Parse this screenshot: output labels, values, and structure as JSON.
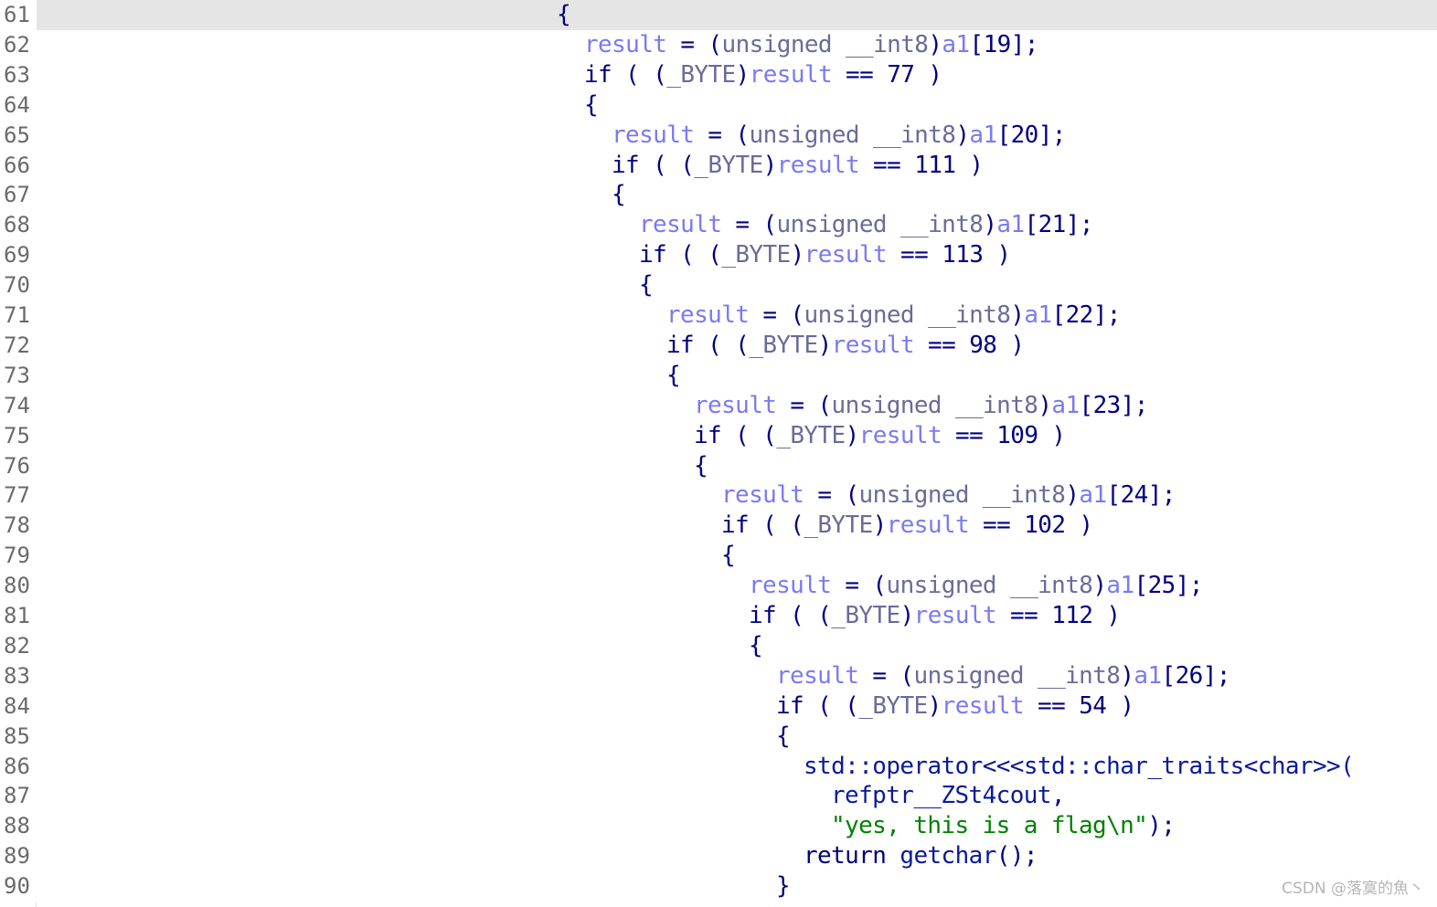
{
  "editor": {
    "lines": [
      {
        "num": "61",
        "indent": 0,
        "tokens": [
          {
            "t": "{",
            "c": "tk-plain"
          }
        ]
      },
      {
        "num": "62",
        "indent": 1,
        "tokens": [
          {
            "t": "result",
            "c": "tk-var"
          },
          {
            "t": " = (",
            "c": "tk-plain"
          },
          {
            "t": "unsigned __int8",
            "c": "tk-type"
          },
          {
            "t": ")",
            "c": "tk-plain"
          },
          {
            "t": "a1",
            "c": "tk-var"
          },
          {
            "t": "[19];",
            "c": "tk-plain"
          }
        ]
      },
      {
        "num": "63",
        "indent": 1,
        "tokens": [
          {
            "t": "if",
            "c": "tk-kw"
          },
          {
            "t": " ( (",
            "c": "tk-plain"
          },
          {
            "t": "_BYTE",
            "c": "tk-type"
          },
          {
            "t": ")",
            "c": "tk-plain"
          },
          {
            "t": "result",
            "c": "tk-var"
          },
          {
            "t": " == 77 )",
            "c": "tk-plain"
          }
        ]
      },
      {
        "num": "64",
        "indent": 1,
        "tokens": [
          {
            "t": "{",
            "c": "tk-plain"
          }
        ]
      },
      {
        "num": "65",
        "indent": 2,
        "tokens": [
          {
            "t": "result",
            "c": "tk-var"
          },
          {
            "t": " = (",
            "c": "tk-plain"
          },
          {
            "t": "unsigned __int8",
            "c": "tk-type"
          },
          {
            "t": ")",
            "c": "tk-plain"
          },
          {
            "t": "a1",
            "c": "tk-var"
          },
          {
            "t": "[20];",
            "c": "tk-plain"
          }
        ]
      },
      {
        "num": "66",
        "indent": 2,
        "tokens": [
          {
            "t": "if",
            "c": "tk-kw"
          },
          {
            "t": " ( (",
            "c": "tk-plain"
          },
          {
            "t": "_BYTE",
            "c": "tk-type"
          },
          {
            "t": ")",
            "c": "tk-plain"
          },
          {
            "t": "result",
            "c": "tk-var"
          },
          {
            "t": " == 111 )",
            "c": "tk-plain"
          }
        ]
      },
      {
        "num": "67",
        "indent": 2,
        "tokens": [
          {
            "t": "{",
            "c": "tk-plain"
          }
        ]
      },
      {
        "num": "68",
        "indent": 3,
        "tokens": [
          {
            "t": "result",
            "c": "tk-var"
          },
          {
            "t": " = (",
            "c": "tk-plain"
          },
          {
            "t": "unsigned __int8",
            "c": "tk-type"
          },
          {
            "t": ")",
            "c": "tk-plain"
          },
          {
            "t": "a1",
            "c": "tk-var"
          },
          {
            "t": "[21];",
            "c": "tk-plain"
          }
        ]
      },
      {
        "num": "69",
        "indent": 3,
        "tokens": [
          {
            "t": "if",
            "c": "tk-kw"
          },
          {
            "t": " ( (",
            "c": "tk-plain"
          },
          {
            "t": "_BYTE",
            "c": "tk-type"
          },
          {
            "t": ")",
            "c": "tk-plain"
          },
          {
            "t": "result",
            "c": "tk-var"
          },
          {
            "t": " == 113 )",
            "c": "tk-plain"
          }
        ]
      },
      {
        "num": "70",
        "indent": 3,
        "tokens": [
          {
            "t": "{",
            "c": "tk-plain"
          }
        ]
      },
      {
        "num": "71",
        "indent": 4,
        "tokens": [
          {
            "t": "result",
            "c": "tk-var"
          },
          {
            "t": " = (",
            "c": "tk-plain"
          },
          {
            "t": "unsigned __int8",
            "c": "tk-type"
          },
          {
            "t": ")",
            "c": "tk-plain"
          },
          {
            "t": "a1",
            "c": "tk-var"
          },
          {
            "t": "[22];",
            "c": "tk-plain"
          }
        ]
      },
      {
        "num": "72",
        "indent": 4,
        "tokens": [
          {
            "t": "if",
            "c": "tk-kw"
          },
          {
            "t": " ( (",
            "c": "tk-plain"
          },
          {
            "t": "_BYTE",
            "c": "tk-type"
          },
          {
            "t": ")",
            "c": "tk-plain"
          },
          {
            "t": "result",
            "c": "tk-var"
          },
          {
            "t": " == 98 )",
            "c": "tk-plain"
          }
        ]
      },
      {
        "num": "73",
        "indent": 4,
        "tokens": [
          {
            "t": "{",
            "c": "tk-plain"
          }
        ]
      },
      {
        "num": "74",
        "indent": 5,
        "tokens": [
          {
            "t": "result",
            "c": "tk-var"
          },
          {
            "t": " = (",
            "c": "tk-plain"
          },
          {
            "t": "unsigned __int8",
            "c": "tk-type"
          },
          {
            "t": ")",
            "c": "tk-plain"
          },
          {
            "t": "a1",
            "c": "tk-var"
          },
          {
            "t": "[23];",
            "c": "tk-plain"
          }
        ]
      },
      {
        "num": "75",
        "indent": 5,
        "tokens": [
          {
            "t": "if",
            "c": "tk-kw"
          },
          {
            "t": " ( (",
            "c": "tk-plain"
          },
          {
            "t": "_BYTE",
            "c": "tk-type"
          },
          {
            "t": ")",
            "c": "tk-plain"
          },
          {
            "t": "result",
            "c": "tk-var"
          },
          {
            "t": " == 109 )",
            "c": "tk-plain"
          }
        ]
      },
      {
        "num": "76",
        "indent": 5,
        "tokens": [
          {
            "t": "{",
            "c": "tk-plain"
          }
        ]
      },
      {
        "num": "77",
        "indent": 6,
        "tokens": [
          {
            "t": "result",
            "c": "tk-var"
          },
          {
            "t": " = (",
            "c": "tk-plain"
          },
          {
            "t": "unsigned __int8",
            "c": "tk-type"
          },
          {
            "t": ")",
            "c": "tk-plain"
          },
          {
            "t": "a1",
            "c": "tk-var"
          },
          {
            "t": "[24];",
            "c": "tk-plain"
          }
        ]
      },
      {
        "num": "78",
        "indent": 6,
        "tokens": [
          {
            "t": "if",
            "c": "tk-kw"
          },
          {
            "t": " ( (",
            "c": "tk-plain"
          },
          {
            "t": "_BYTE",
            "c": "tk-type"
          },
          {
            "t": ")",
            "c": "tk-plain"
          },
          {
            "t": "result",
            "c": "tk-var"
          },
          {
            "t": " == 102 )",
            "c": "tk-plain"
          }
        ]
      },
      {
        "num": "79",
        "indent": 6,
        "tokens": [
          {
            "t": "{",
            "c": "tk-plain"
          }
        ]
      },
      {
        "num": "80",
        "indent": 7,
        "tokens": [
          {
            "t": "result",
            "c": "tk-var"
          },
          {
            "t": " = (",
            "c": "tk-plain"
          },
          {
            "t": "unsigned __int8",
            "c": "tk-type"
          },
          {
            "t": ")",
            "c": "tk-plain"
          },
          {
            "t": "a1",
            "c": "tk-var"
          },
          {
            "t": "[25];",
            "c": "tk-plain"
          }
        ]
      },
      {
        "num": "81",
        "indent": 7,
        "tokens": [
          {
            "t": "if",
            "c": "tk-kw"
          },
          {
            "t": " ( (",
            "c": "tk-plain"
          },
          {
            "t": "_BYTE",
            "c": "tk-type"
          },
          {
            "t": ")",
            "c": "tk-plain"
          },
          {
            "t": "result",
            "c": "tk-var"
          },
          {
            "t": " == 112 )",
            "c": "tk-plain"
          }
        ]
      },
      {
        "num": "82",
        "indent": 7,
        "tokens": [
          {
            "t": "{",
            "c": "tk-plain"
          }
        ]
      },
      {
        "num": "83",
        "indent": 8,
        "tokens": [
          {
            "t": "result",
            "c": "tk-var"
          },
          {
            "t": " = (",
            "c": "tk-plain"
          },
          {
            "t": "unsigned __int8",
            "c": "tk-type"
          },
          {
            "t": ")",
            "c": "tk-plain"
          },
          {
            "t": "a1",
            "c": "tk-var"
          },
          {
            "t": "[26];",
            "c": "tk-plain"
          }
        ]
      },
      {
        "num": "84",
        "indent": 8,
        "tokens": [
          {
            "t": "if",
            "c": "tk-kw"
          },
          {
            "t": " ( (",
            "c": "tk-plain"
          },
          {
            "t": "_BYTE",
            "c": "tk-type"
          },
          {
            "t": ")",
            "c": "tk-plain"
          },
          {
            "t": "result",
            "c": "tk-var"
          },
          {
            "t": " == 54 )",
            "c": "tk-plain"
          }
        ]
      },
      {
        "num": "85",
        "indent": 8,
        "tokens": [
          {
            "t": "{",
            "c": "tk-plain"
          }
        ]
      },
      {
        "num": "86",
        "indent": 9,
        "tokens": [
          {
            "t": "std::operator<<<std::char_traits<char>>(",
            "c": "tk-id"
          }
        ]
      },
      {
        "num": "87",
        "indent": 10,
        "tokens": [
          {
            "t": "refptr__ZSt4cout",
            "c": "tk-id"
          },
          {
            "t": ",",
            "c": "tk-plain"
          }
        ]
      },
      {
        "num": "88",
        "indent": 10,
        "tokens": [
          {
            "t": "\"yes, this is a flag\\n\"",
            "c": "tk-str"
          },
          {
            "t": ");",
            "c": "tk-plain"
          }
        ]
      },
      {
        "num": "89",
        "indent": 9,
        "tokens": [
          {
            "t": "return",
            "c": "tk-kw"
          },
          {
            "t": " ",
            "c": "tk-plain"
          },
          {
            "t": "getchar",
            "c": "tk-id"
          },
          {
            "t": "();",
            "c": "tk-plain"
          }
        ]
      },
      {
        "num": "90",
        "indent": 8,
        "tokens": [
          {
            "t": "}",
            "c": "tk-plain"
          }
        ]
      }
    ]
  },
  "watermark": {
    "text": "CSDN @落寞的魚丶"
  },
  "colors": {
    "background": "#ffffff",
    "active_line": "#e5e5e5",
    "line_number": "#6a6a6a",
    "variable": "#7a7af2",
    "keyword": "#000080",
    "type": "#6b6b9a",
    "string": "#008000"
  }
}
